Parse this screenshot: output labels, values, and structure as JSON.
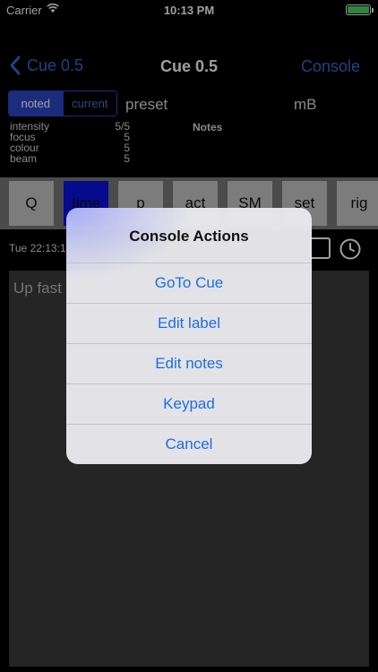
{
  "status_bar": {
    "carrier": "Carrier",
    "time": "10:13 PM"
  },
  "nav": {
    "back_label": "Cue 0.5",
    "title": "Cue 0.5",
    "right_label": "Console"
  },
  "segment": {
    "noted": "noted",
    "current": "current"
  },
  "preset_label": "preset",
  "unit_label": "mB",
  "params": [
    {
      "name": "intensity",
      "value": "5/5"
    },
    {
      "name": "focus",
      "value": "5"
    },
    {
      "name": "colour",
      "value": "5"
    },
    {
      "name": "beam",
      "value": "5"
    }
  ],
  "notes_heading": "Notes",
  "tabs": [
    "Q",
    "time",
    "p",
    "act",
    "SM",
    "set",
    "rig"
  ],
  "timestamp": "Tue 22:13:1",
  "notes_text": "Up fast",
  "dialog": {
    "title": "Console Actions",
    "buttons": [
      "GoTo Cue",
      "Edit label",
      "Edit notes",
      "Keypad",
      "Cancel"
    ]
  },
  "colors": {
    "accent": "#2f6bd9",
    "active_tab": "#0a12e6",
    "segment": "#2c48c9",
    "battery": "#4cd964"
  }
}
